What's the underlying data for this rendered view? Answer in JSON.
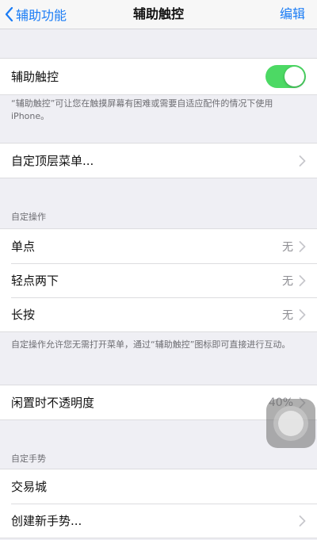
{
  "nav": {
    "back_label": "辅助功能",
    "title": "辅助触控",
    "edit_label": "编辑"
  },
  "assistive_touch": {
    "label": "辅助触控",
    "enabled": true,
    "description": "“辅助触控”可让您在触摸屏幕有困难或需要自适应配件的情况下使用 iPhone。"
  },
  "top_menu": {
    "label": "自定顶层菜单..."
  },
  "custom_actions": {
    "header": "自定操作",
    "items": [
      {
        "label": "单点",
        "value": "无"
      },
      {
        "label": "轻点两下",
        "value": "无"
      },
      {
        "label": "长按",
        "value": "无"
      }
    ],
    "footnote": "自定操作允许您无需打开菜单，通过“辅助触控”图标即可直接进行互动。"
  },
  "idle_opacity": {
    "label": "闲置时不透明度",
    "value": "40%"
  },
  "custom_gestures": {
    "header": "自定手势",
    "items": [
      {
        "label": "交易城"
      },
      {
        "label": "创建新手势..."
      }
    ]
  },
  "colors": {
    "accent": "#1a7cf5",
    "toggle_on": "#4cd964",
    "background": "#efeff4"
  }
}
